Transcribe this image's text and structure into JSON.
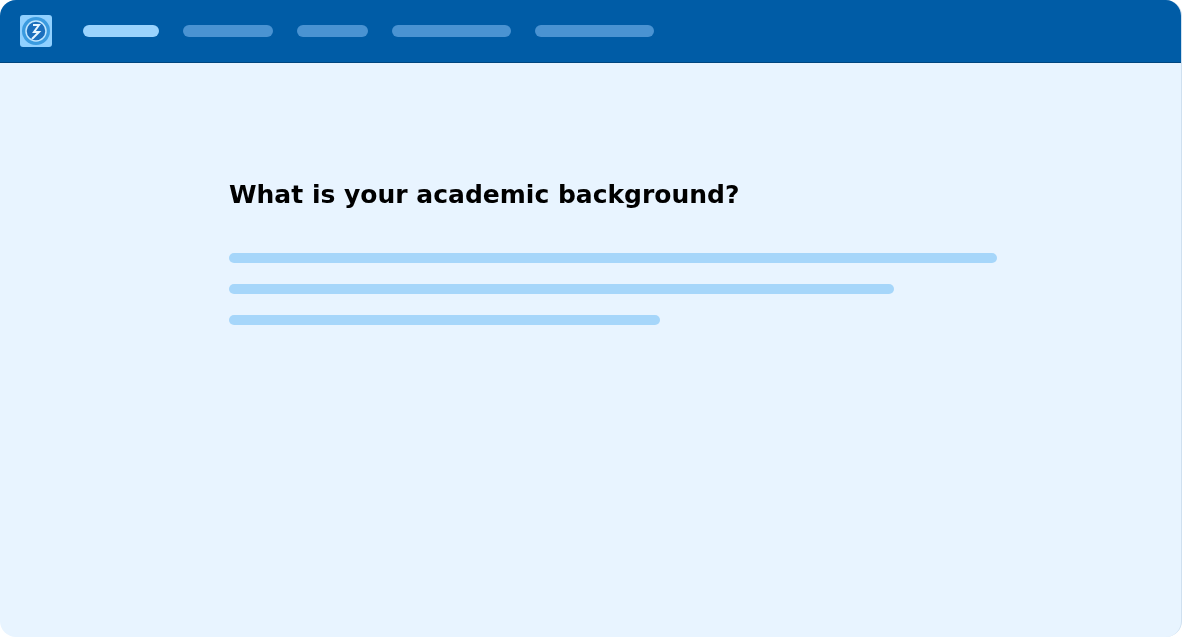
{
  "nav": {
    "items": [
      {
        "selected": true
      },
      {
        "selected": false
      },
      {
        "selected": false
      },
      {
        "selected": false
      },
      {
        "selected": false
      }
    ]
  },
  "question": {
    "title": "What is your academic background?"
  }
}
